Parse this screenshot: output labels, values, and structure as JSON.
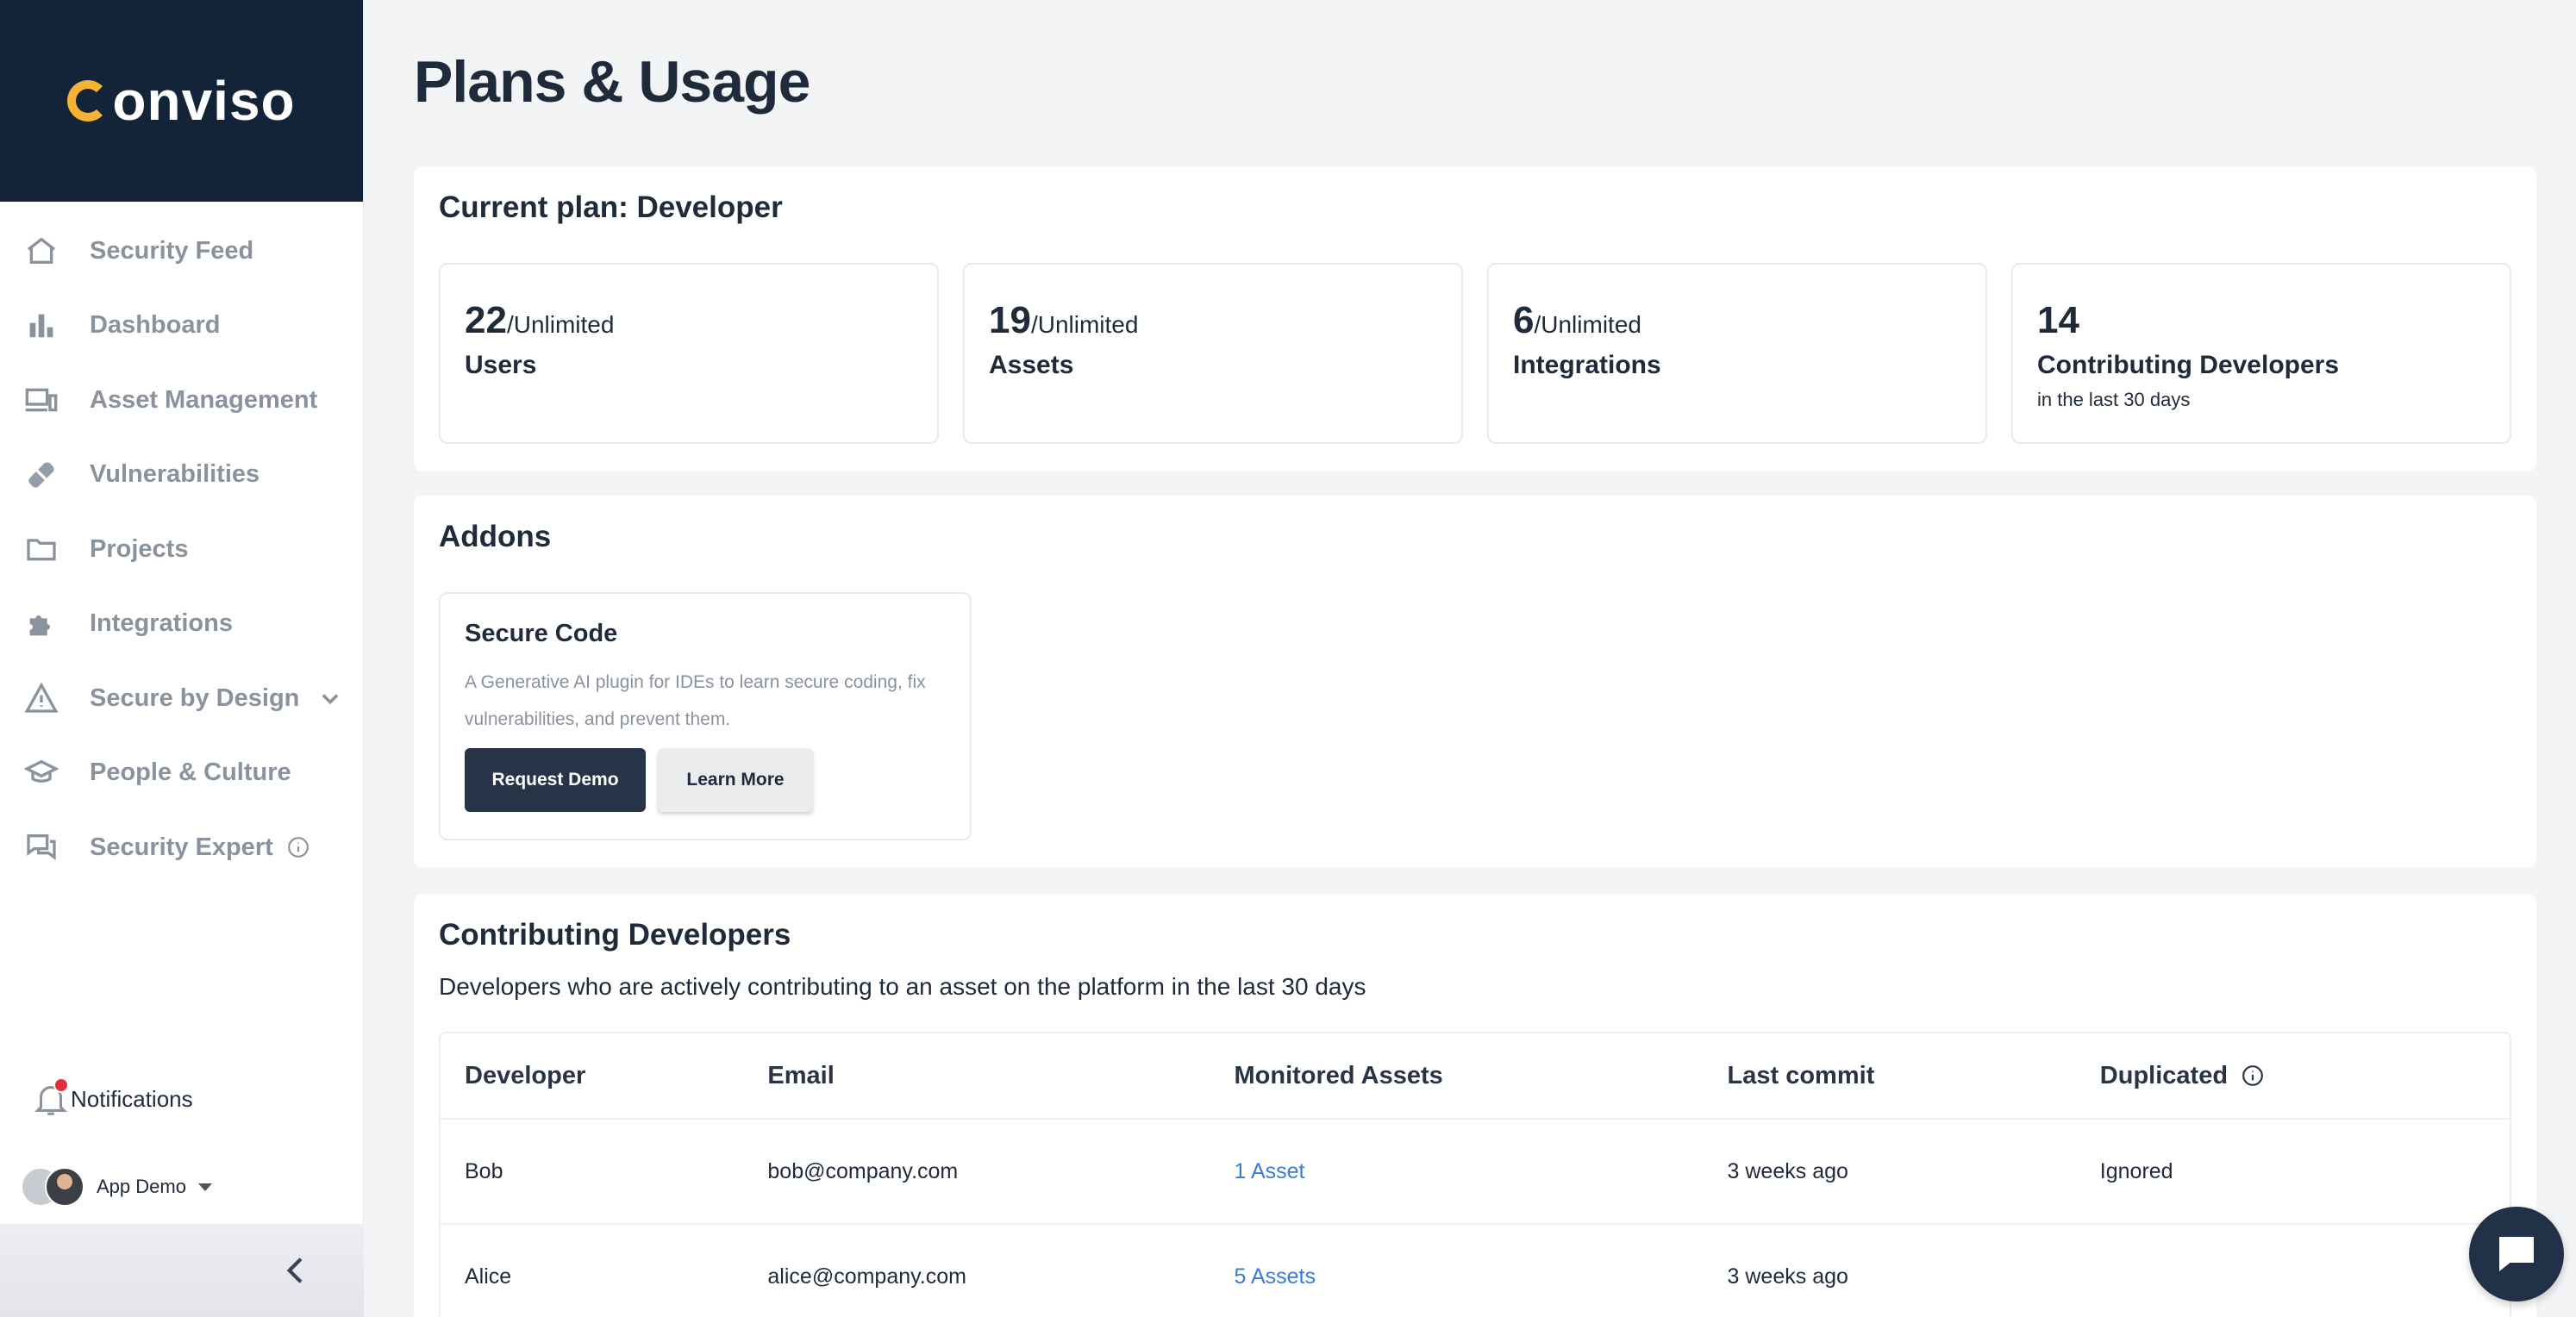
{
  "brand": {
    "name": "onviso"
  },
  "sidebar": {
    "items": [
      {
        "label": "Security Feed",
        "icon": "home-icon"
      },
      {
        "label": "Dashboard",
        "icon": "bar-chart-icon"
      },
      {
        "label": "Asset Management",
        "icon": "devices-icon"
      },
      {
        "label": "Vulnerabilities",
        "icon": "bandage-icon"
      },
      {
        "label": "Projects",
        "icon": "folder-icon"
      },
      {
        "label": "Integrations",
        "icon": "puzzle-icon"
      },
      {
        "label": "Secure by Design",
        "icon": "warning-icon"
      },
      {
        "label": "People & Culture",
        "icon": "graduation-cap-icon"
      },
      {
        "label": "Security Expert",
        "icon": "chat-icon"
      }
    ],
    "notifications_label": "Notifications",
    "user_label": "App Demo"
  },
  "page": {
    "title": "Plans & Usage"
  },
  "plan": {
    "title": "Current plan: Developer",
    "stats": [
      {
        "value": "22",
        "suffix": "/Unlimited",
        "label": "Users",
        "sub": ""
      },
      {
        "value": "19",
        "suffix": "/Unlimited",
        "label": "Assets",
        "sub": ""
      },
      {
        "value": "6",
        "suffix": "/Unlimited",
        "label": "Integrations",
        "sub": ""
      },
      {
        "value": "14",
        "suffix": "",
        "label": "Contributing Developers",
        "sub": "in the last 30 days"
      }
    ]
  },
  "addons": {
    "title": "Addons",
    "item": {
      "title": "Secure Code",
      "description": "A Generative AI plugin for IDEs to learn secure coding, fix vulnerabilities, and prevent them.",
      "primary_label": "Request Demo",
      "secondary_label": "Learn More"
    }
  },
  "developers": {
    "title": "Contributing Developers",
    "description": "Developers who are actively contributing to an asset on the platform in the last 30 days",
    "columns": [
      "Developer",
      "Email",
      "Monitored Assets",
      "Last commit",
      "Duplicated"
    ],
    "rows": [
      {
        "developer": "Bob",
        "email": "bob@company.com",
        "assets": "1 Asset",
        "last_commit": "3 weeks ago",
        "duplicated": "Ignored"
      },
      {
        "developer": "Alice",
        "email": "alice@company.com",
        "assets": "5 Assets",
        "last_commit": "3 weeks ago",
        "duplicated": ""
      }
    ]
  },
  "colors": {
    "brand_dark": "#132338",
    "brand_accent": "#f5b335",
    "link": "#3a7bd5",
    "notification_dot": "#e0303c"
  }
}
